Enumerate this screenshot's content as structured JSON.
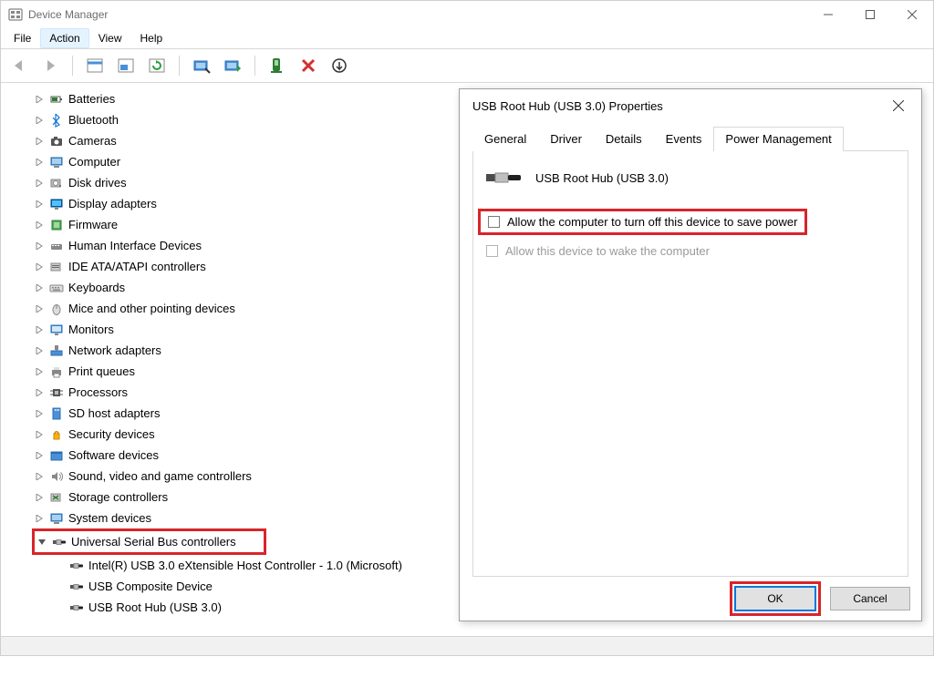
{
  "window": {
    "title": "Device Manager"
  },
  "menu": {
    "items": [
      "File",
      "Action",
      "View",
      "Help"
    ],
    "selected_index": 1
  },
  "toolbar": {
    "buttons": [
      {
        "name": "back-arrow-icon",
        "type": "back"
      },
      {
        "name": "forward-arrow-icon",
        "type": "forward"
      },
      "sep",
      {
        "name": "show-hide-icon",
        "type": "tree"
      },
      {
        "name": "properties-icon",
        "type": "props"
      },
      {
        "name": "refresh-icon",
        "type": "refresh"
      },
      "sep",
      {
        "name": "scan-hardware-icon",
        "type": "scan"
      },
      {
        "name": "enable-device-icon",
        "type": "enable"
      },
      "sep",
      {
        "name": "update-driver-icon",
        "type": "update"
      },
      {
        "name": "uninstall-device-icon",
        "type": "uninstall"
      },
      {
        "name": "add-legacy-icon",
        "type": "add"
      }
    ]
  },
  "tree": [
    {
      "level": 1,
      "expand": ">",
      "icon": "battery",
      "label": "Batteries"
    },
    {
      "level": 1,
      "expand": ">",
      "icon": "bluetooth",
      "label": "Bluetooth"
    },
    {
      "level": 1,
      "expand": ">",
      "icon": "camera",
      "label": "Cameras"
    },
    {
      "level": 1,
      "expand": ">",
      "icon": "computer",
      "label": "Computer"
    },
    {
      "level": 1,
      "expand": ">",
      "icon": "disk",
      "label": "Disk drives"
    },
    {
      "level": 1,
      "expand": ">",
      "icon": "display",
      "label": "Display adapters"
    },
    {
      "level": 1,
      "expand": ">",
      "icon": "firmware",
      "label": "Firmware"
    },
    {
      "level": 1,
      "expand": ">",
      "icon": "hid",
      "label": "Human Interface Devices"
    },
    {
      "level": 1,
      "expand": ">",
      "icon": "ide",
      "label": "IDE ATA/ATAPI controllers"
    },
    {
      "level": 1,
      "expand": ">",
      "icon": "keyboard",
      "label": "Keyboards"
    },
    {
      "level": 1,
      "expand": ">",
      "icon": "mouse",
      "label": "Mice and other pointing devices"
    },
    {
      "level": 1,
      "expand": ">",
      "icon": "monitor",
      "label": "Monitors"
    },
    {
      "level": 1,
      "expand": ">",
      "icon": "network",
      "label": "Network adapters"
    },
    {
      "level": 1,
      "expand": ">",
      "icon": "printer",
      "label": "Print queues"
    },
    {
      "level": 1,
      "expand": ">",
      "icon": "cpu",
      "label": "Processors"
    },
    {
      "level": 1,
      "expand": ">",
      "icon": "sd",
      "label": "SD host adapters"
    },
    {
      "level": 1,
      "expand": ">",
      "icon": "security",
      "label": "Security devices"
    },
    {
      "level": 1,
      "expand": ">",
      "icon": "software",
      "label": "Software devices"
    },
    {
      "level": 1,
      "expand": ">",
      "icon": "audio",
      "label": "Sound, video and game controllers"
    },
    {
      "level": 1,
      "expand": ">",
      "icon": "storage",
      "label": "Storage controllers"
    },
    {
      "level": 1,
      "expand": ">",
      "icon": "system",
      "label": "System devices"
    },
    {
      "level": 1,
      "expand": "v",
      "icon": "usb",
      "label": "Universal Serial Bus controllers",
      "highlight": true
    },
    {
      "level": 2,
      "expand": "",
      "icon": "usb",
      "label": "Intel(R) USB 3.0 eXtensible Host Controller - 1.0 (Microsoft)"
    },
    {
      "level": 2,
      "expand": "",
      "icon": "usb",
      "label": "USB Composite Device"
    },
    {
      "level": 2,
      "expand": "",
      "icon": "usb",
      "label": "USB Root Hub (USB 3.0)"
    }
  ],
  "dialog": {
    "title": "USB Root Hub (USB 3.0) Properties",
    "tabs": [
      "General",
      "Driver",
      "Details",
      "Events",
      "Power Management"
    ],
    "active_tab": 4,
    "device_name": "USB Root Hub (USB 3.0)",
    "opt_allow_turnoff": "Allow the computer to turn off this device to save power",
    "opt_allow_wake": "Allow this device to wake the computer",
    "ok": "OK",
    "cancel": "Cancel"
  }
}
